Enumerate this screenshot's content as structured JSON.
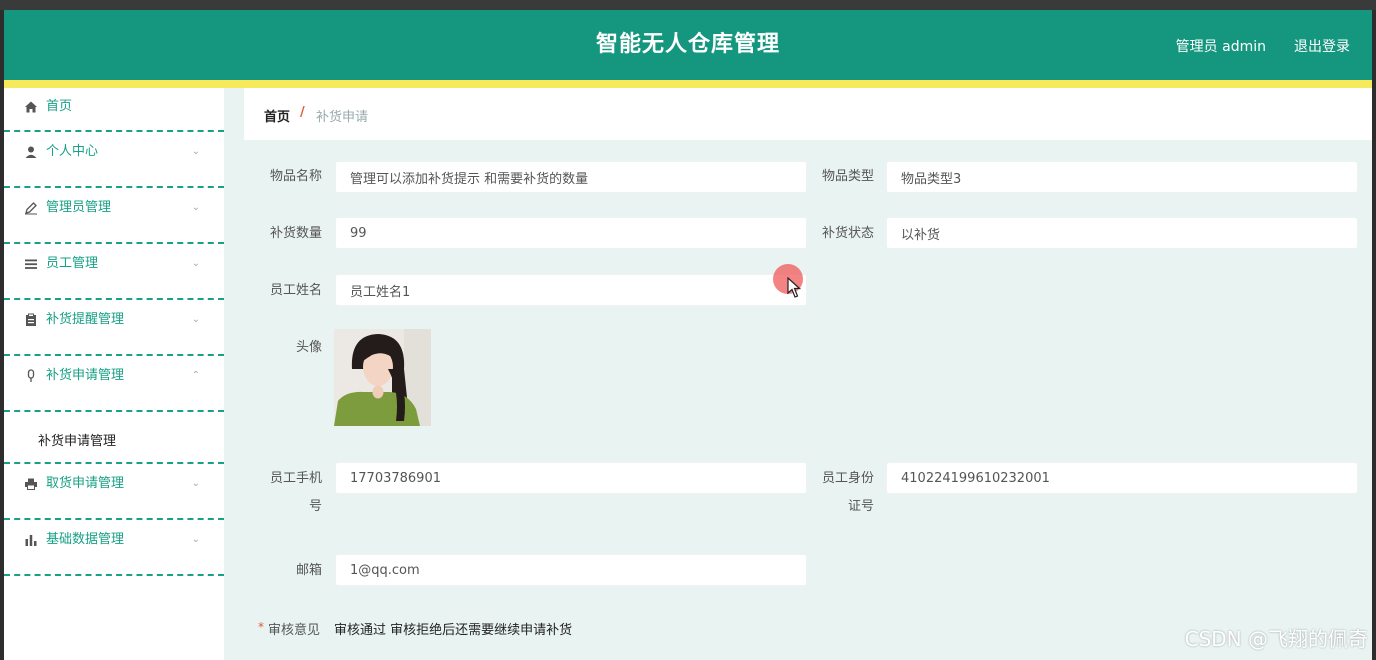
{
  "header": {
    "title": "智能无人仓库管理",
    "user": "管理员 admin",
    "logout": "退出登录"
  },
  "sidebar": {
    "items": [
      {
        "label": "首页",
        "icon": "home-icon"
      },
      {
        "label": "个人中心",
        "icon": "user-icon"
      },
      {
        "label": "管理员管理",
        "icon": "edit-icon"
      },
      {
        "label": "员工管理",
        "icon": "list-icon"
      },
      {
        "label": "补货提醒管理",
        "icon": "clipboard-icon"
      },
      {
        "label": "补货申请管理",
        "icon": "mic-icon"
      },
      {
        "label": "取货申请管理",
        "icon": "printer-icon"
      },
      {
        "label": "基础数据管理",
        "icon": "bar-chart-icon"
      }
    ],
    "submenu": "补货申请管理"
  },
  "breadcrumb": {
    "home": "首页",
    "separator": "/",
    "current": "补货申请"
  },
  "form": {
    "item_name": {
      "label": "物品名称",
      "value": "管理可以添加补货提示 和需要补货的数量"
    },
    "item_type": {
      "label": "物品类型",
      "value": "物品类型3"
    },
    "quantity": {
      "label": "补货数量",
      "value": "99"
    },
    "status": {
      "label": "补货状态",
      "value": "以补货"
    },
    "employee_name": {
      "label": "员工姓名",
      "value": "员工姓名1"
    },
    "avatar": {
      "label": "头像"
    },
    "phone": {
      "label_1": "员工手机",
      "label_2": "号",
      "value": "17703786901"
    },
    "id_card": {
      "label_1": "员工身份",
      "label_2": "证号",
      "value": "410224199610232001"
    },
    "email": {
      "label": "邮箱",
      "value": "1@qq.com"
    },
    "review": {
      "required": "*",
      "label": "审核意见",
      "value": "审核通过 审核拒绝后还需要继续申请补货"
    }
  },
  "watermark": "CSDN @飞翔的佩奇",
  "colors": {
    "header": "#15977f",
    "accent_bar": "#f6ea5c",
    "menu_text": "#17a186",
    "breadcrumb_sep": "#e05a3a"
  }
}
